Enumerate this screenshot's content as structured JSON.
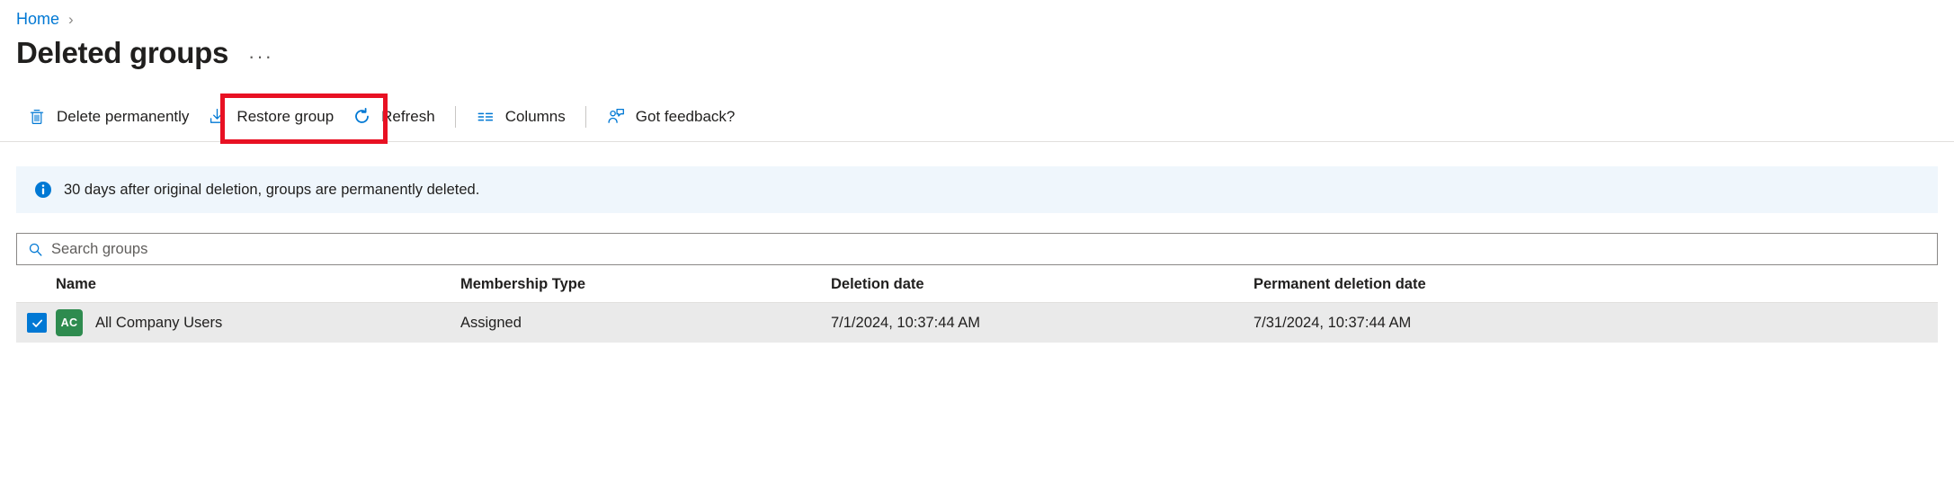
{
  "breadcrumb": {
    "items": [
      {
        "label": "Home"
      }
    ],
    "separator": "›"
  },
  "header": {
    "title": "Deleted groups",
    "ellipsis": "···"
  },
  "toolbar": {
    "buttons": [
      {
        "label": "Delete permanently",
        "icon": "trash-icon"
      },
      {
        "label": "Restore group",
        "icon": "restore-download-icon"
      },
      {
        "label": "Refresh",
        "icon": "refresh-icon"
      },
      {
        "label": "Columns",
        "icon": "columns-icon"
      },
      {
        "label": "Got feedback?",
        "icon": "feedback-person-icon"
      }
    ],
    "highlight": {
      "target": "Restore group",
      "color": "#e81123"
    }
  },
  "banner": {
    "icon": "info-icon",
    "text": "30 days after original deletion, groups are permanently deleted.",
    "background": "#eff6fc",
    "icon_color": "#0078d4"
  },
  "search": {
    "placeholder": "Search groups",
    "value": "",
    "icon": "search-icon"
  },
  "table": {
    "columns": [
      "Name",
      "Membership Type",
      "Deletion date",
      "Permanent deletion date"
    ],
    "rows": [
      {
        "selected": true,
        "avatar_initials": "AC",
        "avatar_color": "#2e8b4f",
        "name": "All Company Users",
        "membership_type": "Assigned",
        "deletion_date": "7/1/2024, 10:37:44 AM",
        "permanent_deletion_date": "7/31/2024, 10:37:44 AM"
      }
    ]
  },
  "colors": {
    "accent": "#0078d4",
    "link": "#0078d4",
    "highlight_red": "#e81123",
    "row_selected_bg": "#eaeaea"
  }
}
